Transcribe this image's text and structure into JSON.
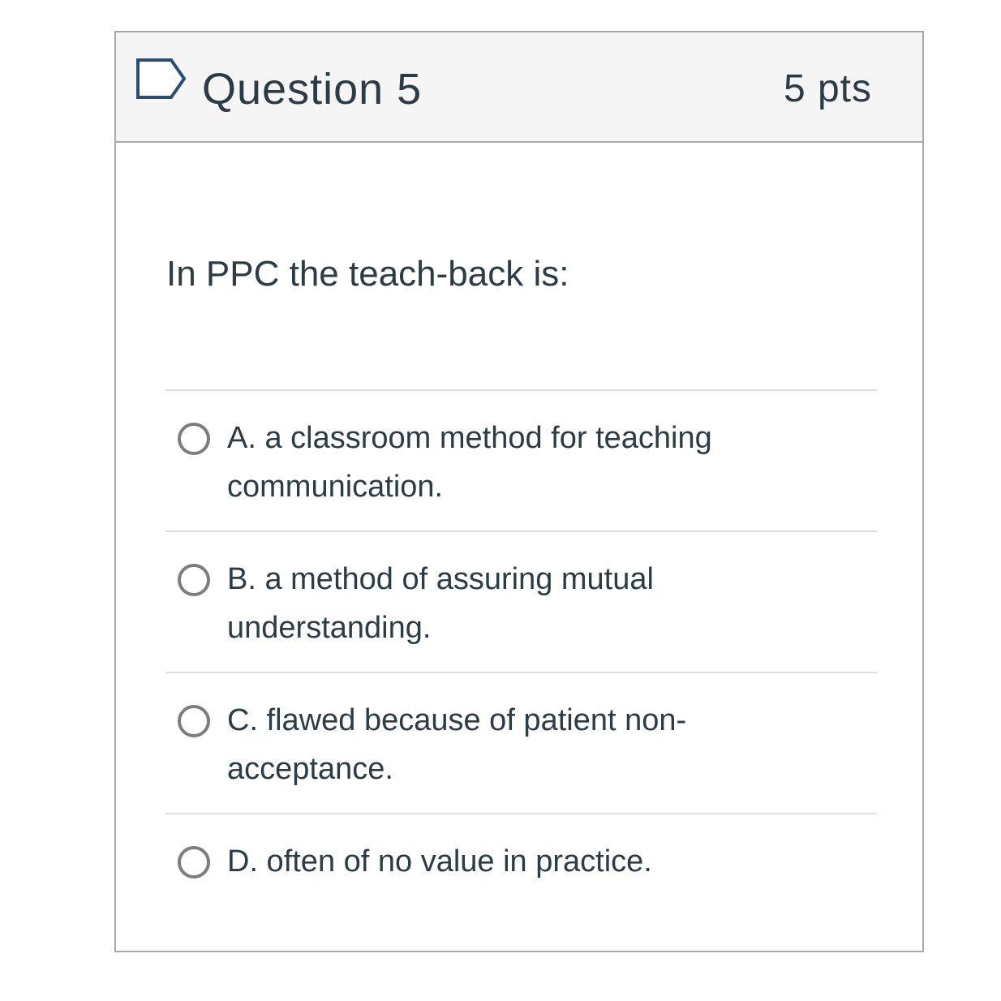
{
  "question": {
    "title": "Question 5",
    "points": "5 pts",
    "flag_icon": "flag-outline-icon",
    "text": "In PPC the teach-back is:"
  },
  "answers": [
    {
      "label": "A. a classroom method for teaching communication.",
      "selected": false
    },
    {
      "label": "B. a method of assuring mutual understanding.",
      "selected": false
    },
    {
      "label": "C. flawed because of patient non-acceptance.",
      "selected": false
    },
    {
      "label": "D. often of no value in practice.",
      "selected": false
    }
  ],
  "colors": {
    "header_bg": "#f5f5f5",
    "border": "#a9a9a9",
    "text": "#2d3b45",
    "flag": "#2b4d73",
    "radio": "#7d7d7d"
  }
}
